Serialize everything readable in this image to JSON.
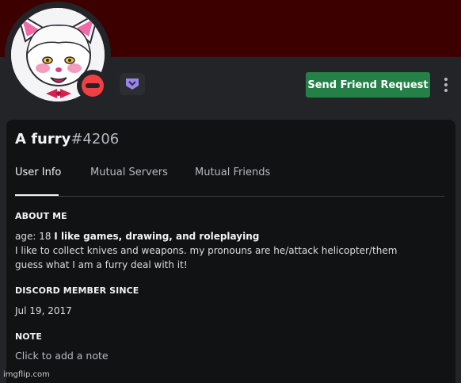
{
  "profile": {
    "username": "A furry",
    "discriminator": "#4206",
    "status": "do-not-disturb",
    "badge_icon": "hypesquad-badge-icon",
    "send_friend_request_label": "Send Friend Request",
    "more_icon": "more-vertical-icon"
  },
  "tabs": [
    {
      "label": "User Info",
      "active": true
    },
    {
      "label": "Mutual Servers",
      "active": false
    },
    {
      "label": "Mutual Friends",
      "active": false
    }
  ],
  "about_me": {
    "title": "ABOUT ME",
    "line1_prefix": "age: 18 ",
    "line1_bold": "I like games, drawing, and roleplaying",
    "line2": "I like to collect knives and weapons. my pronouns are he/attack helicopter/them",
    "line3": "guess what I am a furry deal with it!"
  },
  "member_since": {
    "title": "DISCORD MEMBER SINCE",
    "date": "Jul 19, 2017"
  },
  "note": {
    "title": "NOTE",
    "placeholder": "Click to add a note"
  },
  "watermark": "imgflip.com",
  "colors": {
    "banner": "#3d0000",
    "card": "#111214",
    "accent_green": "#248046",
    "status_dnd": "#f23f43",
    "badge_purple": "#9c84ef"
  }
}
